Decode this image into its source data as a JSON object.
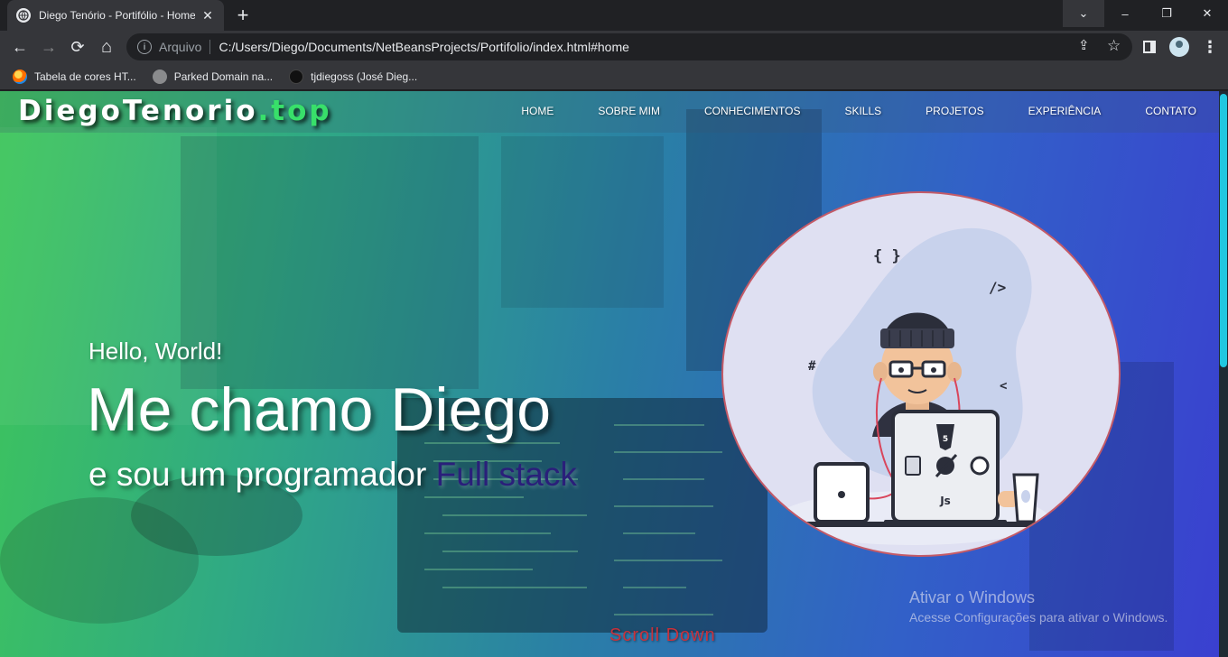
{
  "browser": {
    "tab_title": "Diego Tenório - Portifólio - Home",
    "close_glyph": "✕",
    "new_tab_glyph": "+",
    "window_controls": {
      "dropdown": "⌄",
      "minimize": "–",
      "restore": "❐",
      "close": "✕"
    },
    "nav": {
      "back": "←",
      "forward": "→",
      "reload": "⟳",
      "home": "⌂"
    },
    "omnibox": {
      "info_glyph": "i",
      "scheme_label": "Arquivo",
      "url": "C:/Users/Diego/Documents/NetBeansProjects/Portifolio/index.html#home",
      "share_glyph": "⇪",
      "star_glyph": "☆"
    },
    "menu_glyph": "⋮",
    "bookmarks": [
      {
        "label": "Tabela de cores HT...",
        "icon": "firefox-icon"
      },
      {
        "label": "Parked Domain na...",
        "icon": "globe-icon"
      },
      {
        "label": "tjdiegoss (José Dieg...",
        "icon": "github-icon"
      }
    ]
  },
  "site": {
    "logo_name": "DiegoTenorio",
    "logo_tld": ".top",
    "nav": [
      "HOME",
      "SOBRE MIM",
      "CONHECIMENTOS",
      "SKILLS",
      "PROJETOS",
      "EXPERIÊNCIA",
      "CONTATO"
    ],
    "hero": {
      "hello": "Hello, World!",
      "name": "Me chamo Diego",
      "subtitle_prefix": "e sou um programador ",
      "subtitle_highlight": "Full stack"
    },
    "illustration": {
      "glyphs": [
        "{ }",
        "/>",
        "#",
        "<"
      ],
      "laptop_label": "Js"
    },
    "scroll_down": "Scroll Down"
  },
  "os_watermark": {
    "line1": "Ativar o Windows",
    "line2": "Acesse Configurações para ativar o Windows."
  },
  "colors": {
    "gradient_start": "#3ec65a",
    "gradient_end": "#3a3fd0",
    "logo_tld": "#38e06a",
    "highlight": "#2a1f7a",
    "scroll_down": "#c8323c",
    "scrollbar_thumb": "#21c7e0"
  }
}
